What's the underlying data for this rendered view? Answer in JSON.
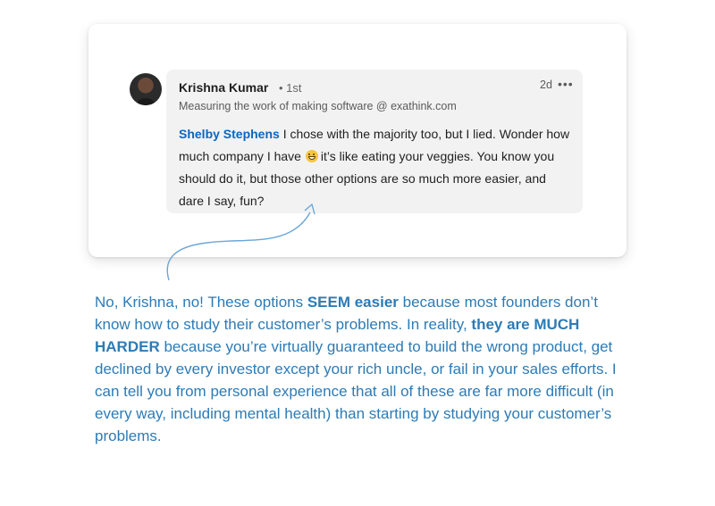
{
  "post": {
    "author_name": "Krishna Kumar",
    "connection": "• 1st",
    "headline": "Measuring the work of making software @ exathink.com",
    "timestamp": "2d",
    "more_icon": "•••",
    "mention": "Shelby Stephens",
    "comment_part1": " I chose with the majority too, but I lied. Wonder how much company I have ",
    "emoji": "grinning-face-emoji",
    "comment_part2": "it’s like eating your veggies. You know you should do it, but those other options are so much more easier, and dare I say, fun?"
  },
  "annotation": {
    "text_1": "No, Krishna, no! These options ",
    "bold_1": "SEEM easier",
    "text_2": " because most founders don’t know how to study their customer’s problems. In reality, ",
    "bold_2": "they are MUCH HARDER",
    "text_3": " because you’re virtually guaranteed to build the wrong product, get declined by every investor except your rich uncle, or fail in your sales efforts. I can tell you from personal experience that all of these are far more difficult (in every way, including mental health) than starting by studying your customer’s problems."
  },
  "colors": {
    "mention": "#0a66c2",
    "annotation": "#2d7bb6",
    "bubble": "#f2f2f2"
  }
}
